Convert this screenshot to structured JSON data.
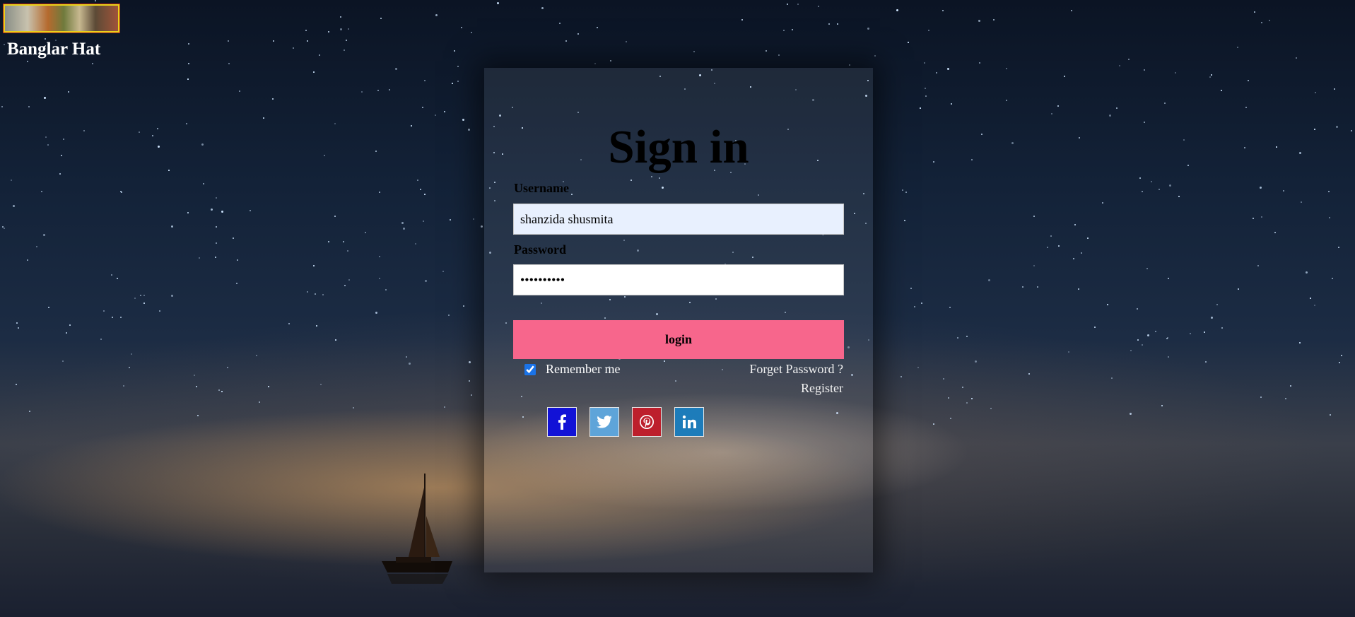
{
  "brand": {
    "name": "Banglar Hat"
  },
  "form": {
    "title": "Sign in",
    "username_label": "Username",
    "username_value": "shanzida shusmita",
    "password_label": "Password",
    "password_value": "••••••••••",
    "login_label": "login",
    "remember_label": "Remember me",
    "remember_checked": true,
    "forgot_label": "Forget Password ?",
    "register_label": "Register"
  },
  "social": [
    {
      "name": "facebook",
      "icon": "facebook-icon",
      "color": "#1212d6"
    },
    {
      "name": "twitter",
      "icon": "twitter-icon",
      "color": "#5ea4d9"
    },
    {
      "name": "pinterest",
      "icon": "pinterest-icon",
      "color": "#bd1f2c"
    },
    {
      "name": "linkedin",
      "icon": "linkedin-icon",
      "color": "#1d7cba"
    }
  ],
  "colors": {
    "login_button": "#f7668c",
    "username_bg": "#e8f0fe"
  }
}
